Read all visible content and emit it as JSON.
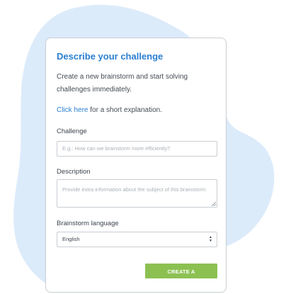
{
  "colors": {
    "accent": "#2a7fd1",
    "button": "#8cc152",
    "blob": "#dcebfa"
  },
  "card": {
    "title": "Describe your challenge",
    "intro": "Create a new brainstorm and start solving challenges immediately.",
    "explain_link": "Click here",
    "explain_rest": " for a short explanation."
  },
  "form": {
    "challenge_label": "Challenge",
    "challenge_placeholder": "E.g.: How can we brainstorm more efficiently?",
    "description_label": "Description",
    "description_placeholder": "Provide extra information about the subject of this brainstorm.",
    "language_label": "Brainstorm language",
    "language_value": "English",
    "submit_label": "CREATE A BRAINSTORM"
  },
  "icons": {
    "select_arrows": "chevron-up-down-icon",
    "resize_handle": "resize-handle-icon"
  }
}
